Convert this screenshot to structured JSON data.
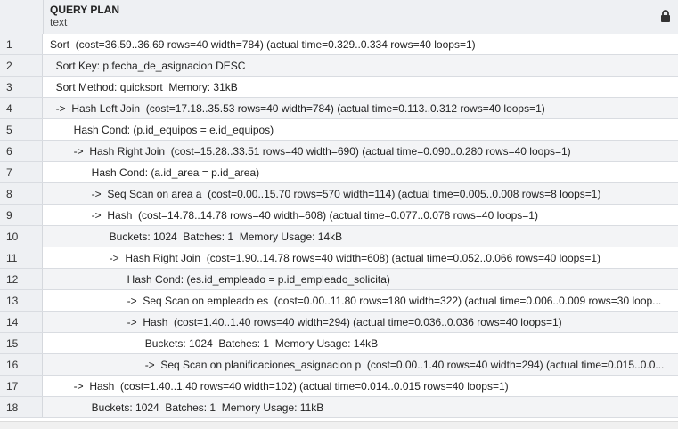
{
  "header": {
    "column_name": "QUERY PLAN",
    "column_type": "text",
    "lock_icon": "lock-icon"
  },
  "rows": [
    {
      "num": "1",
      "text": "Sort  (cost=36.59..36.69 rows=40 width=784) (actual time=0.329..0.334 rows=40 loops=1)"
    },
    {
      "num": "2",
      "text": "  Sort Key: p.fecha_de_asignacion DESC"
    },
    {
      "num": "3",
      "text": "  Sort Method: quicksort  Memory: 31kB"
    },
    {
      "num": "4",
      "text": "  ->  Hash Left Join  (cost=17.18..35.53 rows=40 width=784) (actual time=0.113..0.312 rows=40 loops=1)"
    },
    {
      "num": "5",
      "text": "        Hash Cond: (p.id_equipos = e.id_equipos)"
    },
    {
      "num": "6",
      "text": "        ->  Hash Right Join  (cost=15.28..33.51 rows=40 width=690) (actual time=0.090..0.280 rows=40 loops=1)"
    },
    {
      "num": "7",
      "text": "              Hash Cond: (a.id_area = p.id_area)"
    },
    {
      "num": "8",
      "text": "              ->  Seq Scan on area a  (cost=0.00..15.70 rows=570 width=114) (actual time=0.005..0.008 rows=8 loops=1)"
    },
    {
      "num": "9",
      "text": "              ->  Hash  (cost=14.78..14.78 rows=40 width=608) (actual time=0.077..0.078 rows=40 loops=1)"
    },
    {
      "num": "10",
      "text": "                    Buckets: 1024  Batches: 1  Memory Usage: 14kB"
    },
    {
      "num": "11",
      "text": "                    ->  Hash Right Join  (cost=1.90..14.78 rows=40 width=608) (actual time=0.052..0.066 rows=40 loops=1)"
    },
    {
      "num": "12",
      "text": "                          Hash Cond: (es.id_empleado = p.id_empleado_solicita)"
    },
    {
      "num": "13",
      "text": "                          ->  Seq Scan on empleado es  (cost=0.00..11.80 rows=180 width=322) (actual time=0.006..0.009 rows=30 loop..."
    },
    {
      "num": "14",
      "text": "                          ->  Hash  (cost=1.40..1.40 rows=40 width=294) (actual time=0.036..0.036 rows=40 loops=1)"
    },
    {
      "num": "15",
      "text": "                                Buckets: 1024  Batches: 1  Memory Usage: 14kB"
    },
    {
      "num": "16",
      "text": "                                ->  Seq Scan on planificaciones_asignacion p  (cost=0.00..1.40 rows=40 width=294) (actual time=0.015..0.0..."
    },
    {
      "num": "17",
      "text": "        ->  Hash  (cost=1.40..1.40 rows=40 width=102) (actual time=0.014..0.015 rows=40 loops=1)"
    },
    {
      "num": "18",
      "text": "              Buckets: 1024  Batches: 1  Memory Usage: 11kB"
    }
  ]
}
